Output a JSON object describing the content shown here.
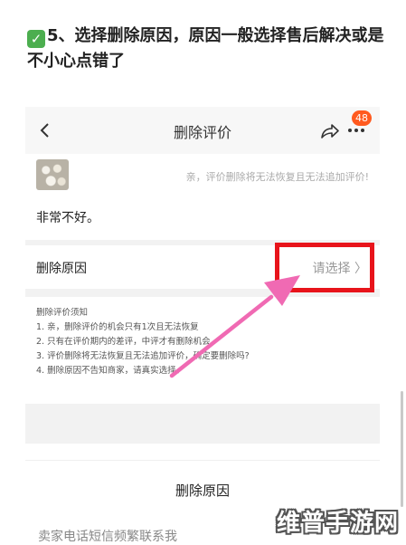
{
  "heading": {
    "check": "✓",
    "text": "5、选择删除原因，原因一般选择售后解决或是不小心点错了"
  },
  "nav": {
    "title": "删除评价",
    "badge": "48"
  },
  "review": {
    "warning": "亲，评价删除将无法恢复且无法追加评价!",
    "text": "非常不好。"
  },
  "reason": {
    "label": "删除原因",
    "select": "请选择 〉"
  },
  "notice": {
    "title": "删除评价须知",
    "items": [
      "1. 亲，删除评价的机会只有1次且无法恢复",
      "2. 只有在评价期内的差评，中评才有删除机会",
      "3. 评价删除将无法恢复且无法追加评价，确定要删除吗?",
      "4. 删除原因不告知商家，请真实选择。"
    ]
  },
  "sheet": {
    "title": "删除原因",
    "option": "卖家电话短信频繁联系我"
  },
  "watermark": "维普手游网",
  "colors": {
    "highlight_box": "#e8141b",
    "arrow": "#f06ab3",
    "badge": "#ff5a1f",
    "check": "#4cae4f"
  }
}
